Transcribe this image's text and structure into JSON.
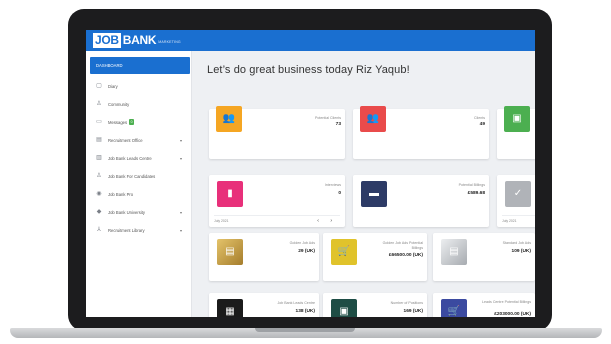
{
  "app": {
    "logo_part1": "JOB",
    "logo_part2": "BANK",
    "logo_tag": "MARKETING"
  },
  "sidebar": {
    "items": [
      {
        "label": "DASHBOARD",
        "icon": "none",
        "active": true
      },
      {
        "label": "Diary",
        "icon": "calendar-icon"
      },
      {
        "label": "Community",
        "icon": "person-icon"
      },
      {
        "label": "Messages",
        "icon": "message-icon",
        "badge": "0"
      },
      {
        "label": "Recruitment Office",
        "icon": "building-icon",
        "chevron": true
      },
      {
        "label": "Job Bank Leads Centre",
        "icon": "chart-icon",
        "chevron": true
      },
      {
        "label": "Job Bank For Candidates",
        "icon": "people-icon"
      },
      {
        "label": "Job Bank Pro",
        "icon": "eye-icon"
      },
      {
        "label": "Job Bank University",
        "icon": "graduation-icon",
        "chevron": true
      },
      {
        "label": "Recruitment Library",
        "icon": "tree-icon",
        "chevron": true
      }
    ]
  },
  "main": {
    "greeting": "Let’s do great business today Riz Yaqub!",
    "row1": [
      {
        "title": "Potential Clients",
        "value": "73",
        "icon": "people-icon",
        "color": "#f5a623"
      },
      {
        "title": "Clients",
        "value": "49",
        "icon": "people-icon",
        "color": "#e94b4b"
      },
      {
        "title": "",
        "value": "",
        "icon": "briefcase-icon",
        "color": "#4caf50"
      }
    ],
    "row2": [
      {
        "title": "Interviews",
        "value": "0",
        "icon": "door-icon",
        "color": "#e8307a",
        "footer": "July 2021",
        "nav": "‹ ›"
      },
      {
        "title": "Potential Billings",
        "value": "£589.68",
        "icon": "card-icon",
        "color": "#2d3b66"
      },
      {
        "title": "",
        "value": "",
        "icon": "check-icon",
        "color": "#b0b3b8",
        "footer": "July 2021"
      }
    ],
    "row3": [
      {
        "title": "Golden Job Ads",
        "value": "29 (UK)",
        "icon": "gold-icon",
        "color": "#c9a14a"
      },
      {
        "title": "Golden Job Ads Potential Billings",
        "value": "£66500.00 (UK)",
        "icon": "cart-icon",
        "color": "#e0c32b"
      },
      {
        "title": "Standard Job Ads",
        "value": "109 (UK)",
        "icon": "silver-icon",
        "color": "#bfc3c8"
      }
    ],
    "row4": [
      {
        "title": "Job Bank Leads Centre",
        "value": "138 (UK)",
        "icon": "building-icon",
        "color": "#1b1b1b"
      },
      {
        "title": "Number of Positions",
        "value": "169 (UK)",
        "icon": "monitor-icon",
        "color": "#1e4d45"
      },
      {
        "title": "Leads Centre Potential Billings",
        "value": "£203000.00 (UK)",
        "icon": "cart-icon",
        "color": "#3b4aa0"
      }
    ]
  }
}
